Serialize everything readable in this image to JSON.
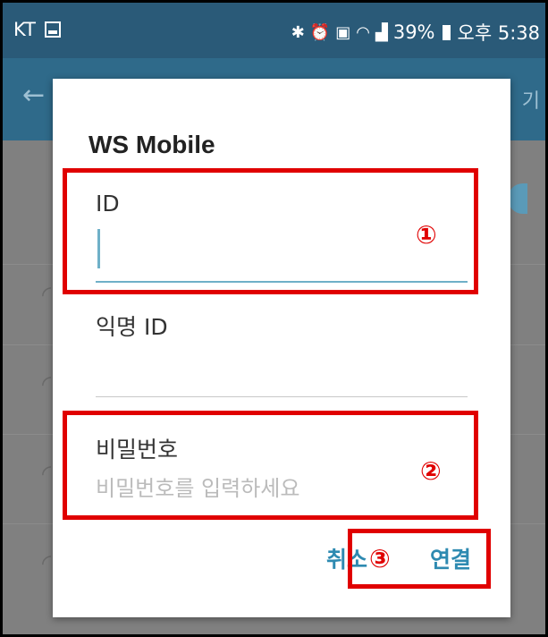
{
  "status_bar": {
    "carrier": "KT",
    "battery": "39%",
    "time": "오후 5:38",
    "icons": [
      "image-icon",
      "bluetooth-icon",
      "alarm-icon",
      "hd-icon",
      "wifi-icon",
      "signal-icon",
      "battery-icon"
    ]
  },
  "app": {
    "header_right": "기"
  },
  "dialog": {
    "title": "WS Mobile",
    "id_label": "ID",
    "id_value": "",
    "anon_label": "익명 ID",
    "anon_value": "",
    "password_label": "비밀번호",
    "password_placeholder": "비밀번호를 입력하세요",
    "cancel_label": "취소",
    "connect_label": "연결"
  },
  "annotations": [
    "①",
    "②",
    "③"
  ],
  "colors": {
    "status_bar": "#2a5a78",
    "accent": "#2e8ab1",
    "annotation": "#e00000"
  }
}
